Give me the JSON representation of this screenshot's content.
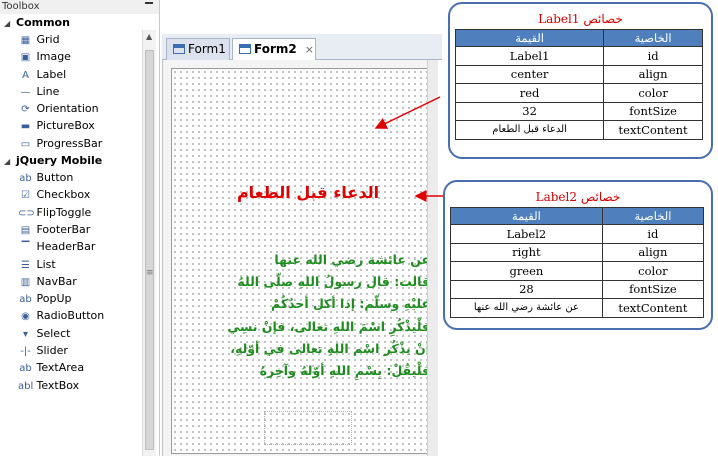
{
  "toolbox": {
    "title": "Toolbox",
    "groups": [
      {
        "label": "Common",
        "items": [
          {
            "label": "Grid",
            "icon": "grid-icon",
            "glyph": "▦"
          },
          {
            "label": "Image",
            "icon": "image-icon",
            "glyph": "▣"
          },
          {
            "label": "Label",
            "icon": "label-icon",
            "glyph": "A"
          },
          {
            "label": "Line",
            "icon": "line-icon",
            "glyph": "—"
          },
          {
            "label": "Orientation",
            "icon": "orientation-icon",
            "glyph": "⟳"
          },
          {
            "label": "PictureBox",
            "icon": "picturebox-icon",
            "glyph": "▬"
          },
          {
            "label": "ProgressBar",
            "icon": "progressbar-icon",
            "glyph": "▭"
          }
        ]
      },
      {
        "label": "jQuery Mobile",
        "items": [
          {
            "label": "Button",
            "icon": "button-icon",
            "glyph": "ab"
          },
          {
            "label": "Checkbox",
            "icon": "checkbox-icon",
            "glyph": "☑"
          },
          {
            "label": "FlipToggle",
            "icon": "fliptoggle-icon",
            "glyph": "⊂⊃"
          },
          {
            "label": "FooterBar",
            "icon": "footerbar-icon",
            "glyph": "▤"
          },
          {
            "label": "HeaderBar",
            "icon": "headerbar-icon",
            "glyph": "▔"
          },
          {
            "label": "List",
            "icon": "list-icon",
            "glyph": "☰"
          },
          {
            "label": "NavBar",
            "icon": "navbar-icon",
            "glyph": "▥"
          },
          {
            "label": "PopUp",
            "icon": "popup-icon",
            "glyph": "ab"
          },
          {
            "label": "RadioButton",
            "icon": "radiobutton-icon",
            "glyph": "◉"
          },
          {
            "label": "Select",
            "icon": "select-icon",
            "glyph": "▾"
          },
          {
            "label": "Slider",
            "icon": "slider-icon",
            "glyph": "-|-"
          },
          {
            "label": "TextArea",
            "icon": "textarea-icon",
            "glyph": "ab"
          },
          {
            "label": "TextBox",
            "icon": "textbox-icon",
            "glyph": "abl"
          }
        ]
      }
    ]
  },
  "tabs": [
    {
      "label": "Form1",
      "active": false
    },
    {
      "label": "Form2",
      "active": true
    }
  ],
  "tab_close_glyph": "×",
  "form": {
    "label1_text": "الدعاء قبل الطعام",
    "label2_lines": [
      "عن عائشة رضي الله عنها",
      "قالت: قال رسولُ اللهِ صلّى اللهُ",
      "عليْهِ وسلّم: إذا أكل أحدُكُمْ",
      "فلْيذْكُرِ اسْمَ اللهِ تعالى، فإنْ نسِي",
      "أنْ يذْكُر اسْم اللهِ تعالى في أوّلهِ،",
      "فلْيقُلْ: بِسْمِ اللهِ أوّلهُ وآخِرهُ"
    ],
    "label1_color": "#e00000",
    "label2_color": "#1e8c1e"
  },
  "panel1": {
    "title": "خصائص Label1",
    "col_value": "القيمة",
    "col_property": "الخاصية",
    "rows": [
      {
        "value": "Label1",
        "property": "id"
      },
      {
        "value": "center",
        "property": "align"
      },
      {
        "value": "red",
        "property": "color"
      },
      {
        "value": "32",
        "property": "fontSize"
      },
      {
        "value": "الدعاء قبل الطعام",
        "property": "textContent"
      }
    ]
  },
  "panel2": {
    "title": "خصائص Label2",
    "col_value": "القيمة",
    "col_property": "الخاصية",
    "rows": [
      {
        "value": "Label2",
        "property": "id"
      },
      {
        "value": "right",
        "property": "align"
      },
      {
        "value": "green",
        "property": "color"
      },
      {
        "value": "28",
        "property": "fontSize"
      },
      {
        "value": "عن عائشة رضي الله عنها",
        "property": "textContent"
      }
    ]
  },
  "colors": {
    "accent_blue": "#4f80bd",
    "panel_border": "#4a6fb0",
    "title_red": "#d40000",
    "arrow_red": "#e00000"
  }
}
